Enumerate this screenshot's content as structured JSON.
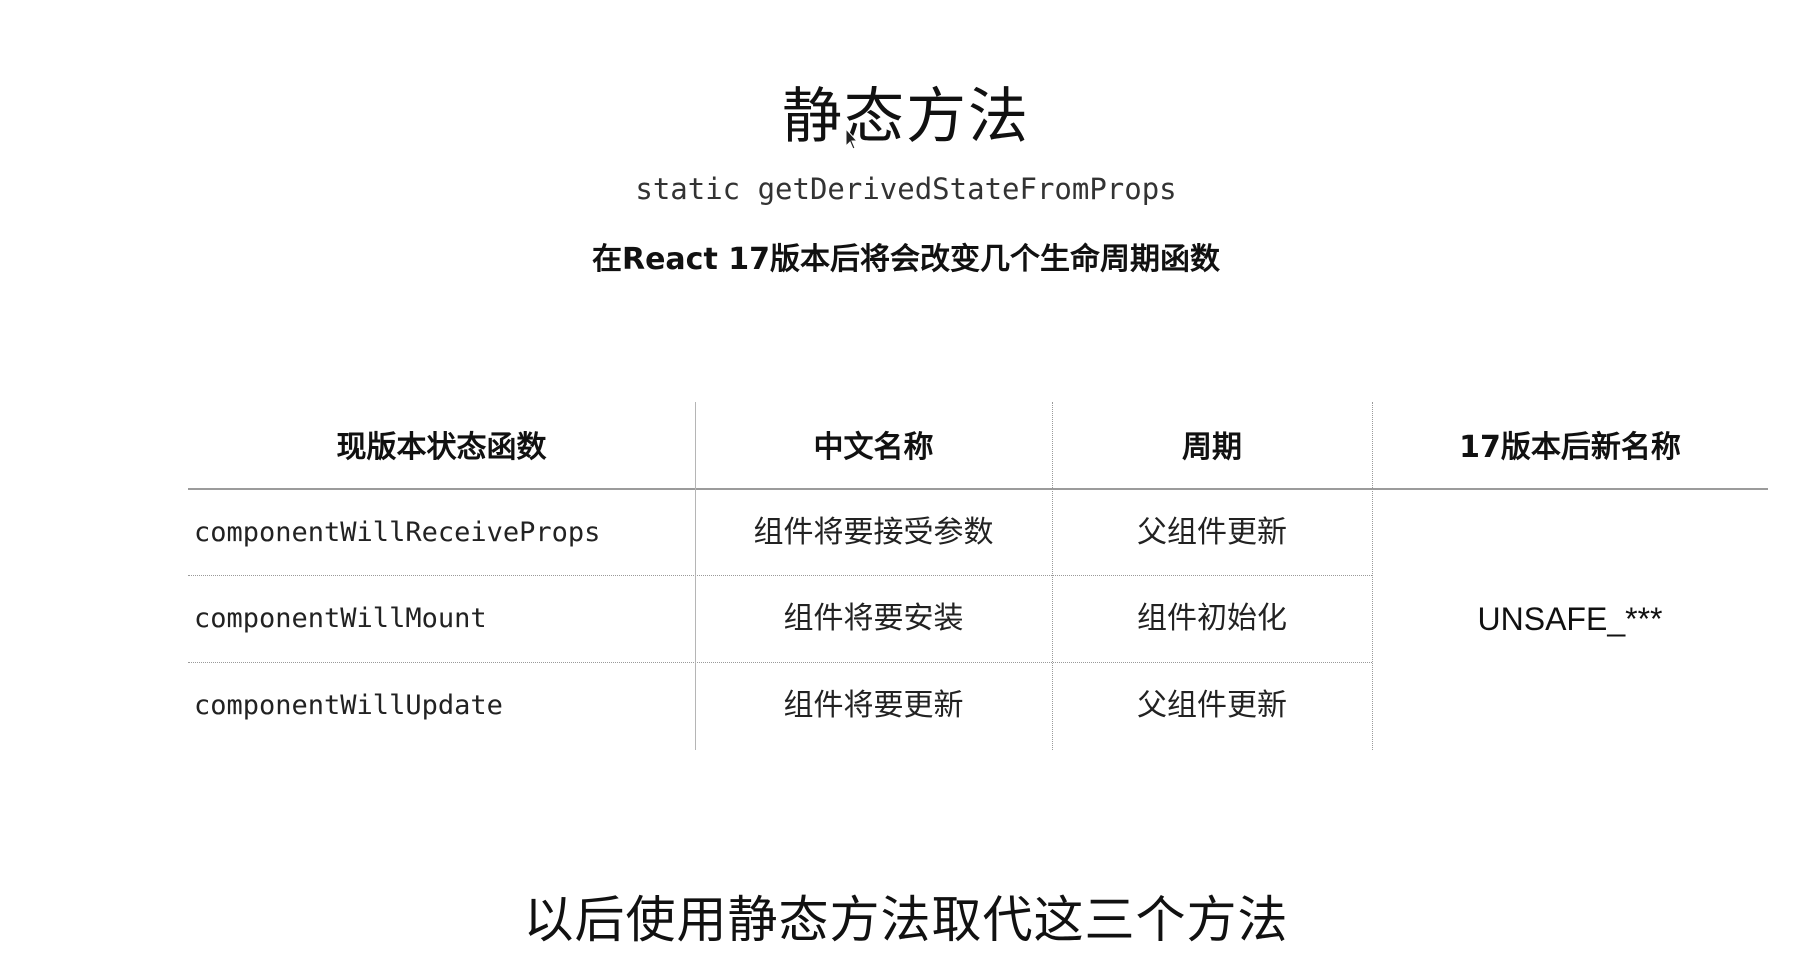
{
  "slide": {
    "title": "静态方法",
    "code_line": "static getDerivedStateFromProps",
    "note": "在React 17版本后将会改变几个生命周期函数",
    "footer": "以后使用静态方法取代这三个方法"
  },
  "table": {
    "headers": [
      "现版本状态函数",
      "中文名称",
      "周期",
      "17版本后新名称"
    ],
    "rows": [
      {
        "method": "componentWillReceiveProps",
        "cn_name": "组件将要接受参数",
        "cycle": "父组件更新"
      },
      {
        "method": "componentWillMount",
        "cn_name": "组件将要安装",
        "cycle": "组件初始化"
      },
      {
        "method": "componentWillUpdate",
        "cn_name": "组件将要更新",
        "cycle": "父组件更新"
      }
    ],
    "new_name": "UNSAFE_***"
  },
  "icons": {
    "cursor": "mouse-pointer-icon"
  }
}
